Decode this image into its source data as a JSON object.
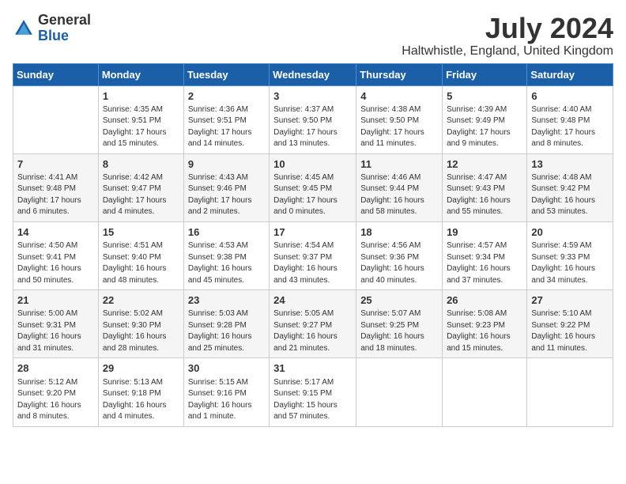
{
  "logo": {
    "general": "General",
    "blue": "Blue"
  },
  "title": {
    "month_year": "July 2024",
    "location": "Haltwhistle, England, United Kingdom"
  },
  "days_of_week": [
    "Sunday",
    "Monday",
    "Tuesday",
    "Wednesday",
    "Thursday",
    "Friday",
    "Saturday"
  ],
  "weeks": [
    [
      {
        "day": "",
        "info": ""
      },
      {
        "day": "1",
        "info": "Sunrise: 4:35 AM\nSunset: 9:51 PM\nDaylight: 17 hours and 15 minutes."
      },
      {
        "day": "2",
        "info": "Sunrise: 4:36 AM\nSunset: 9:51 PM\nDaylight: 17 hours and 14 minutes."
      },
      {
        "day": "3",
        "info": "Sunrise: 4:37 AM\nSunset: 9:50 PM\nDaylight: 17 hours and 13 minutes."
      },
      {
        "day": "4",
        "info": "Sunrise: 4:38 AM\nSunset: 9:50 PM\nDaylight: 17 hours and 11 minutes."
      },
      {
        "day": "5",
        "info": "Sunrise: 4:39 AM\nSunset: 9:49 PM\nDaylight: 17 hours and 9 minutes."
      },
      {
        "day": "6",
        "info": "Sunrise: 4:40 AM\nSunset: 9:48 PM\nDaylight: 17 hours and 8 minutes."
      }
    ],
    [
      {
        "day": "7",
        "info": "Sunrise: 4:41 AM\nSunset: 9:48 PM\nDaylight: 17 hours and 6 minutes."
      },
      {
        "day": "8",
        "info": "Sunrise: 4:42 AM\nSunset: 9:47 PM\nDaylight: 17 hours and 4 minutes."
      },
      {
        "day": "9",
        "info": "Sunrise: 4:43 AM\nSunset: 9:46 PM\nDaylight: 17 hours and 2 minutes."
      },
      {
        "day": "10",
        "info": "Sunrise: 4:45 AM\nSunset: 9:45 PM\nDaylight: 17 hours and 0 minutes."
      },
      {
        "day": "11",
        "info": "Sunrise: 4:46 AM\nSunset: 9:44 PM\nDaylight: 16 hours and 58 minutes."
      },
      {
        "day": "12",
        "info": "Sunrise: 4:47 AM\nSunset: 9:43 PM\nDaylight: 16 hours and 55 minutes."
      },
      {
        "day": "13",
        "info": "Sunrise: 4:48 AM\nSunset: 9:42 PM\nDaylight: 16 hours and 53 minutes."
      }
    ],
    [
      {
        "day": "14",
        "info": "Sunrise: 4:50 AM\nSunset: 9:41 PM\nDaylight: 16 hours and 50 minutes."
      },
      {
        "day": "15",
        "info": "Sunrise: 4:51 AM\nSunset: 9:40 PM\nDaylight: 16 hours and 48 minutes."
      },
      {
        "day": "16",
        "info": "Sunrise: 4:53 AM\nSunset: 9:38 PM\nDaylight: 16 hours and 45 minutes."
      },
      {
        "day": "17",
        "info": "Sunrise: 4:54 AM\nSunset: 9:37 PM\nDaylight: 16 hours and 43 minutes."
      },
      {
        "day": "18",
        "info": "Sunrise: 4:56 AM\nSunset: 9:36 PM\nDaylight: 16 hours and 40 minutes."
      },
      {
        "day": "19",
        "info": "Sunrise: 4:57 AM\nSunset: 9:34 PM\nDaylight: 16 hours and 37 minutes."
      },
      {
        "day": "20",
        "info": "Sunrise: 4:59 AM\nSunset: 9:33 PM\nDaylight: 16 hours and 34 minutes."
      }
    ],
    [
      {
        "day": "21",
        "info": "Sunrise: 5:00 AM\nSunset: 9:31 PM\nDaylight: 16 hours and 31 minutes."
      },
      {
        "day": "22",
        "info": "Sunrise: 5:02 AM\nSunset: 9:30 PM\nDaylight: 16 hours and 28 minutes."
      },
      {
        "day": "23",
        "info": "Sunrise: 5:03 AM\nSunset: 9:28 PM\nDaylight: 16 hours and 25 minutes."
      },
      {
        "day": "24",
        "info": "Sunrise: 5:05 AM\nSunset: 9:27 PM\nDaylight: 16 hours and 21 minutes."
      },
      {
        "day": "25",
        "info": "Sunrise: 5:07 AM\nSunset: 9:25 PM\nDaylight: 16 hours and 18 minutes."
      },
      {
        "day": "26",
        "info": "Sunrise: 5:08 AM\nSunset: 9:23 PM\nDaylight: 16 hours and 15 minutes."
      },
      {
        "day": "27",
        "info": "Sunrise: 5:10 AM\nSunset: 9:22 PM\nDaylight: 16 hours and 11 minutes."
      }
    ],
    [
      {
        "day": "28",
        "info": "Sunrise: 5:12 AM\nSunset: 9:20 PM\nDaylight: 16 hours and 8 minutes."
      },
      {
        "day": "29",
        "info": "Sunrise: 5:13 AM\nSunset: 9:18 PM\nDaylight: 16 hours and 4 minutes."
      },
      {
        "day": "30",
        "info": "Sunrise: 5:15 AM\nSunset: 9:16 PM\nDaylight: 16 hours and 1 minute."
      },
      {
        "day": "31",
        "info": "Sunrise: 5:17 AM\nSunset: 9:15 PM\nDaylight: 15 hours and 57 minutes."
      },
      {
        "day": "",
        "info": ""
      },
      {
        "day": "",
        "info": ""
      },
      {
        "day": "",
        "info": ""
      }
    ]
  ]
}
